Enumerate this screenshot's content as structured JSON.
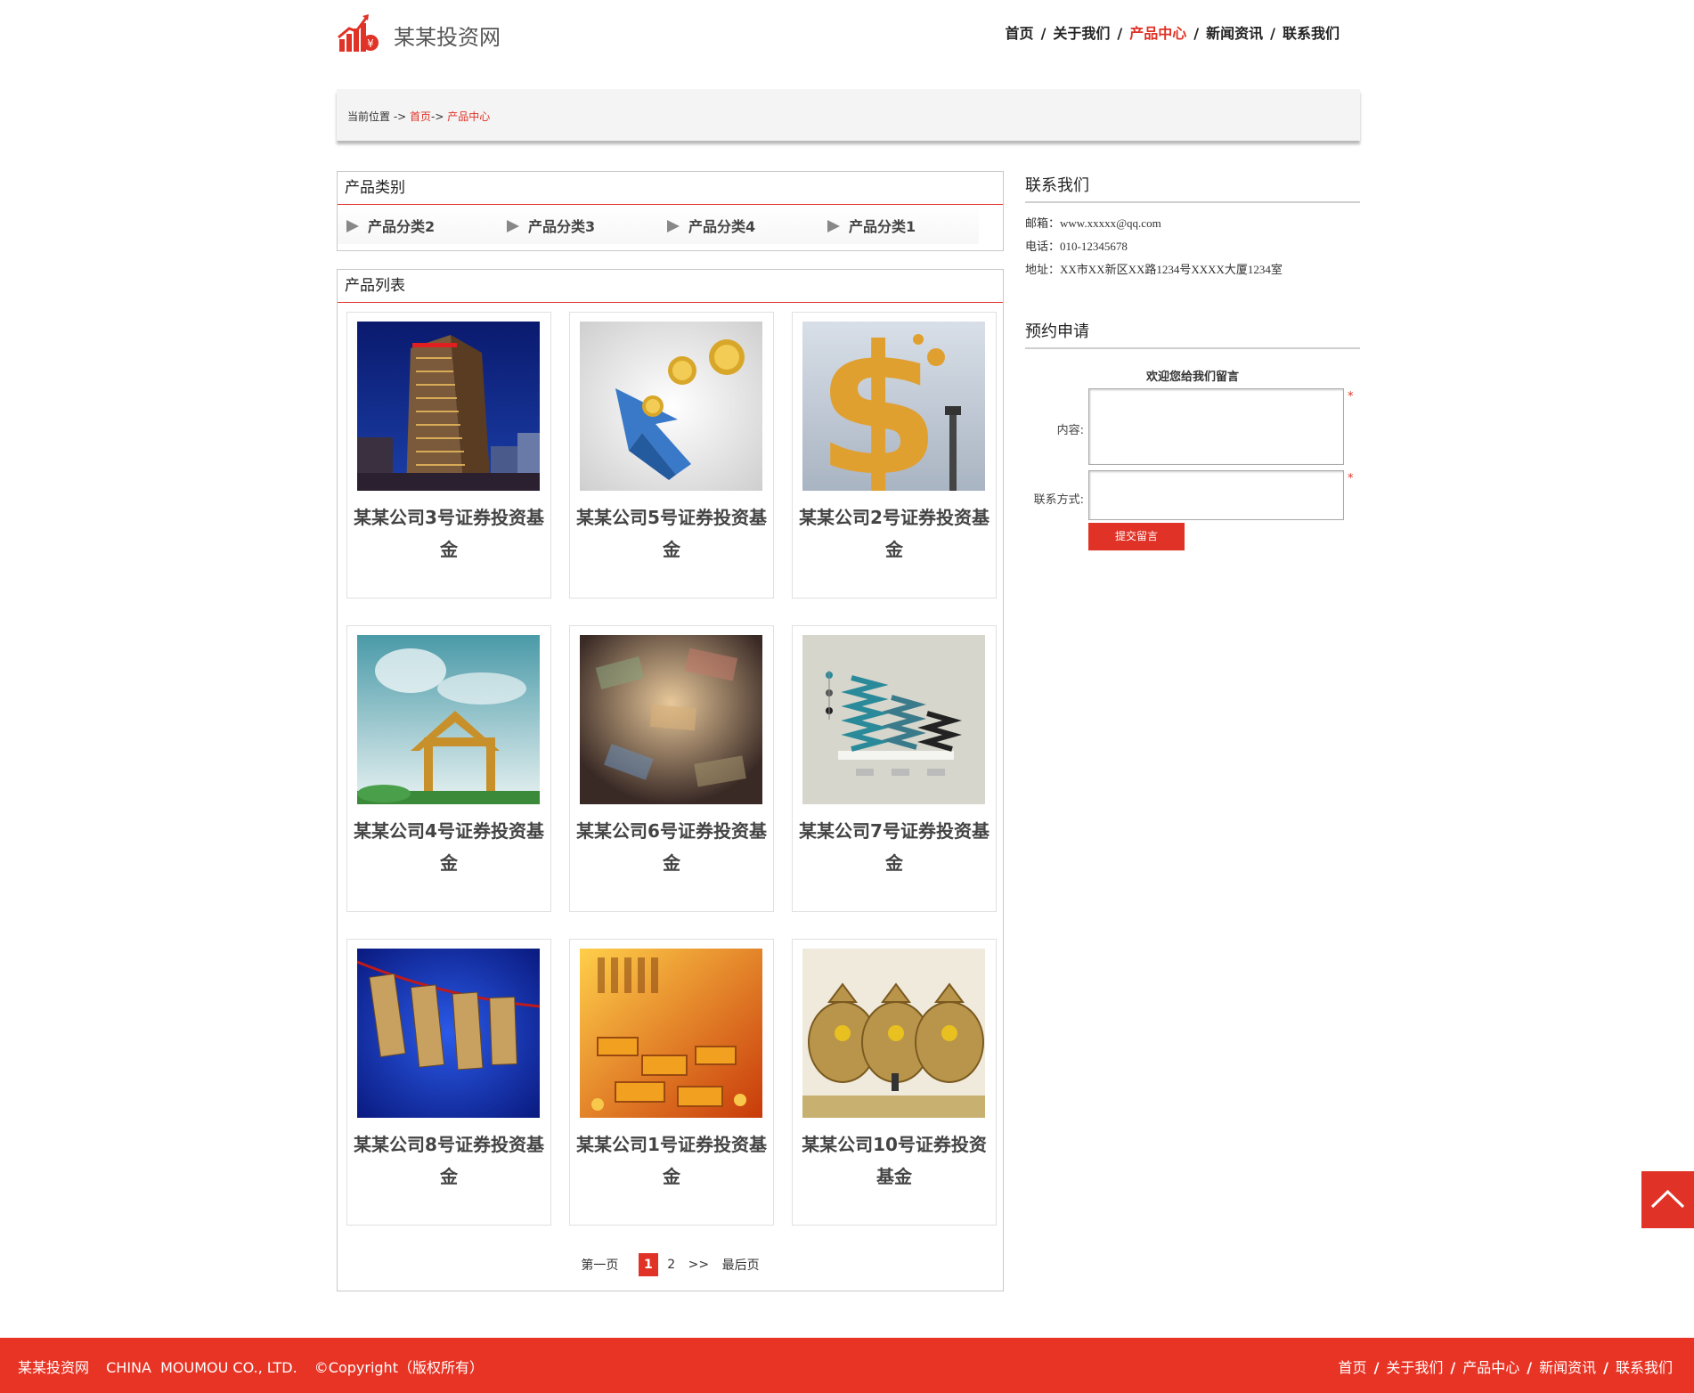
{
  "site": {
    "name": "某某投资网"
  },
  "nav": [
    {
      "label": "首页",
      "active": false
    },
    {
      "label": "关于我们",
      "active": false
    },
    {
      "label": "产品中心",
      "active": true
    },
    {
      "label": "新闻资讯",
      "active": false
    },
    {
      "label": "联系我们",
      "active": false
    }
  ],
  "breadcrumb": {
    "prefix": "当前位置 -> ",
    "home": "首页",
    "arrow": "-> ",
    "current": "产品中心"
  },
  "categories": {
    "title": "产品类别",
    "items": [
      "产品分类2",
      "产品分类3",
      "产品分类4",
      "产品分类1"
    ]
  },
  "products": {
    "title": "产品列表",
    "items": [
      {
        "name": "某某公司3号证券投资基金",
        "image": "skyscraper-night"
      },
      {
        "name": "某某公司5号证券投资基金",
        "image": "blue-cursor-gold-coins"
      },
      {
        "name": "某某公司2号证券投资基金",
        "image": "gold-dollar-sign"
      },
      {
        "name": "某某公司4号证券投资基金",
        "image": "loan-character-house"
      },
      {
        "name": "某某公司6号证券投资基金",
        "image": "banknotes-pile"
      },
      {
        "name": "某某公司7号证券投资基金",
        "image": "spring-bar-chart"
      },
      {
        "name": "某某公司8号证券投资基金",
        "image": "dollars-on-clothesline"
      },
      {
        "name": "某某公司1号证券投资基金",
        "image": "gold-bars-keyboard"
      },
      {
        "name": "某某公司10号证券投资基金",
        "image": "gold-money-bags"
      }
    ]
  },
  "pagination": {
    "first": "第一页",
    "current": "1",
    "next_page": "2",
    "next": ">>",
    "last": "最后页"
  },
  "contact": {
    "title": "联系我们",
    "email_label": "邮箱：",
    "email": "www.xxxxx@qq.com",
    "phone_label": "电话：",
    "phone": "010-12345678",
    "address_label": "地址：",
    "address": "XX市XX新区XX路1234号XXXX大厦1234室"
  },
  "booking": {
    "title": "预约申请",
    "welcome": "欢迎您给我们留言",
    "content_label": "内容:",
    "contact_label": "联系方式:",
    "required_mark": "*",
    "submit_label": "提交留言"
  },
  "footer": {
    "name": "某某投资网",
    "company": "CHINA  MOUMOU CO., LTD.",
    "copyright": "©Copyright（版权所有）"
  },
  "colors": {
    "accent": "#e03226",
    "footer_bg": "#e83425",
    "text": "#333333"
  },
  "icons": {
    "logo": "bar-chart-yuan-icon",
    "back_to_top": "chevron-up-icon",
    "category_bullet": "triangle-right-icon"
  }
}
